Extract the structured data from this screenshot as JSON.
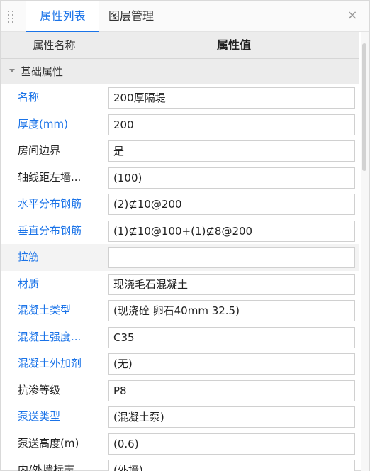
{
  "tabs": [
    {
      "label": "属性列表",
      "active": true
    },
    {
      "label": "图层管理",
      "active": false
    }
  ],
  "close_symbol": "×",
  "header": {
    "name": "属性名称",
    "value": "属性值"
  },
  "group": {
    "label": "基础属性"
  },
  "properties": [
    {
      "name": "名称",
      "value": "200厚隔堤",
      "color": "#1a73e8"
    },
    {
      "name": "厚度(mm)",
      "value": "200",
      "color": "#1a73e8"
    },
    {
      "name": "房间边界",
      "value": "是",
      "color": "#222222"
    },
    {
      "name": "轴线距左墙...",
      "value": "(100)",
      "color": "#222222"
    },
    {
      "name": "水平分布钢筋",
      "value": "(2)⊈10@200",
      "color": "#1a73e8"
    },
    {
      "name": "垂直分布钢筋",
      "value": "(1)⊈10@100+(1)⊈8@200",
      "color": "#1a73e8"
    },
    {
      "name": "拉筋",
      "value": "",
      "color": "#1a73e8"
    },
    {
      "name": "材质",
      "value": "现浇毛石混凝土",
      "color": "#1a73e8"
    },
    {
      "name": "混凝土类型",
      "value": "(现浇砼 卵石40mm 32.5)",
      "color": "#1a73e8"
    },
    {
      "name": "混凝土强度...",
      "value": "C35",
      "color": "#1a73e8"
    },
    {
      "name": "混凝土外加剂",
      "value": "(无)",
      "color": "#1a73e8"
    },
    {
      "name": "抗渗等级",
      "value": "P8",
      "color": "#222222"
    },
    {
      "name": "泵送类型",
      "value": "(混凝土泵)",
      "color": "#1a73e8"
    },
    {
      "name": "泵送高度(m)",
      "value": "(0.6)",
      "color": "#222222"
    },
    {
      "name": "内/外墙标志",
      "value": "(外墙)",
      "color": "#222222"
    }
  ]
}
